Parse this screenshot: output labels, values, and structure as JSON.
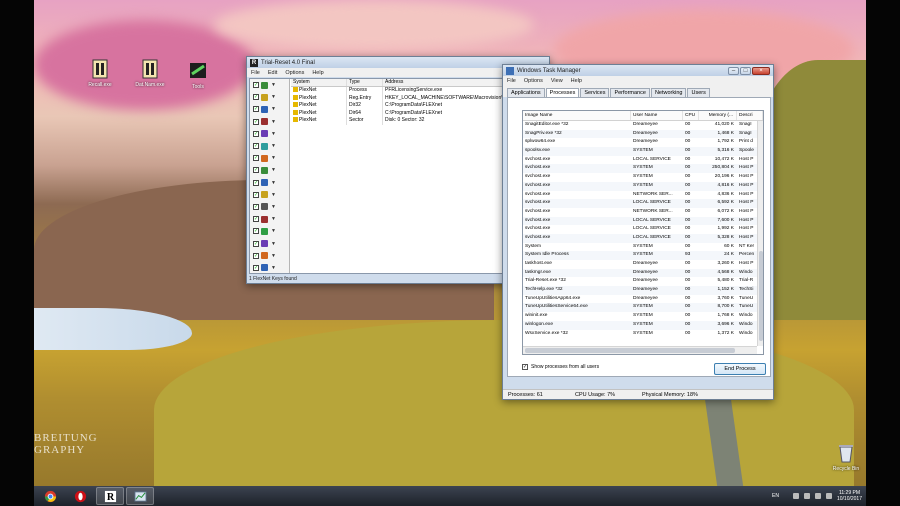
{
  "watermark": {
    "line1": "BREITUNG",
    "line2": "GRAPHY"
  },
  "desktop_icons": [
    {
      "label": "Recall.exe"
    },
    {
      "label": "Dat.Nam.exe"
    },
    {
      "label": "Tools"
    },
    {
      "label": "Recycle Bin"
    }
  ],
  "trial_reset": {
    "title": "Trial-Reset 4.0 Final",
    "menu": [
      "File",
      "Edit",
      "Options",
      "Help"
    ],
    "columns": [
      "System",
      "Type",
      "Address"
    ],
    "rows": [
      {
        "system": "PlexNet",
        "type": "Process",
        "address": "PFRLicensingService.exe"
      },
      {
        "system": "PlexNet",
        "type": "Reg.Entry",
        "address": "HKEY_LOCAL_MACHINE\\SOFTWARE\\Macrovision\\"
      },
      {
        "system": "PlexNet",
        "type": "Dir32",
        "address": "C:\\ProgramData\\FLEXnet"
      },
      {
        "system": "PlexNet",
        "type": "Dir64",
        "address": "C:\\ProgramData\\FLEXnet"
      },
      {
        "system": "PlexNet",
        "type": "Sector",
        "address": "Disk: 0 Sector: 32"
      }
    ],
    "status": "1 FlexNet Keys found"
  },
  "task_manager": {
    "title": "Windows Task Manager",
    "menu": [
      "File",
      "Options",
      "View",
      "Help"
    ],
    "tabs": [
      "Applications",
      "Processes",
      "Services",
      "Performance",
      "Networking",
      "Users"
    ],
    "active_tab": "Processes",
    "columns": [
      "Image Name",
      "User Name",
      "CPU",
      "Memory (...",
      "Descri"
    ],
    "rows": [
      {
        "name": "SnagitEditor.exe *32",
        "user": "Dreameyee",
        "cpu": "00",
        "mem": "41,020 K",
        "desc": "SnagI"
      },
      {
        "name": "SnagPriv.exe *32",
        "user": "Dreameyee",
        "cpu": "00",
        "mem": "1,468 K",
        "desc": "SnagI"
      },
      {
        "name": "splwow64.exe",
        "user": "Dreameyee",
        "cpu": "00",
        "mem": "1,792 K",
        "desc": "Print d"
      },
      {
        "name": "spoolsv.exe",
        "user": "SYSTEM",
        "cpu": "00",
        "mem": "5,316 K",
        "desc": "Spoole"
      },
      {
        "name": "svchost.exe",
        "user": "LOCAL SERVICE",
        "cpu": "00",
        "mem": "10,472 K",
        "desc": "Host P"
      },
      {
        "name": "svchost.exe",
        "user": "SYSTEM",
        "cpu": "00",
        "mem": "250,804 K",
        "desc": "Host P"
      },
      {
        "name": "svchost.exe",
        "user": "SYSTEM",
        "cpu": "00",
        "mem": "20,196 K",
        "desc": "Host P"
      },
      {
        "name": "svchost.exe",
        "user": "SYSTEM",
        "cpu": "00",
        "mem": "4,816 K",
        "desc": "Host P"
      },
      {
        "name": "svchost.exe",
        "user": "NETWORK SER...",
        "cpu": "00",
        "mem": "4,836 K",
        "desc": "Host P"
      },
      {
        "name": "svchost.exe",
        "user": "LOCAL SERVICE",
        "cpu": "00",
        "mem": "6,592 K",
        "desc": "Host P"
      },
      {
        "name": "svchost.exe",
        "user": "NETWORK SER...",
        "cpu": "00",
        "mem": "6,072 K",
        "desc": "Host P"
      },
      {
        "name": "svchost.exe",
        "user": "LOCAL SERVICE",
        "cpu": "00",
        "mem": "7,600 K",
        "desc": "Host P"
      },
      {
        "name": "svchost.exe",
        "user": "LOCAL SERVICE",
        "cpu": "00",
        "mem": "1,992 K",
        "desc": "Host P"
      },
      {
        "name": "svchost.exe",
        "user": "LOCAL SERVICE",
        "cpu": "00",
        "mem": "5,328 K",
        "desc": "Host P"
      },
      {
        "name": "System",
        "user": "SYSTEM",
        "cpu": "00",
        "mem": "60 K",
        "desc": "NT Ker"
      },
      {
        "name": "System Idle Process",
        "user": "SYSTEM",
        "cpu": "93",
        "mem": "24 K",
        "desc": "Percen"
      },
      {
        "name": "taskhost.exe",
        "user": "Dreameyee",
        "cpu": "00",
        "mem": "3,260 K",
        "desc": "Host P"
      },
      {
        "name": "taskmgr.exe",
        "user": "Dreameyee",
        "cpu": "00",
        "mem": "4,568 K",
        "desc": "Windo"
      },
      {
        "name": "Trial-Reset.exe *32",
        "user": "Dreameyee",
        "cpu": "00",
        "mem": "5,480 K",
        "desc": "Trial-R"
      },
      {
        "name": "TechHelp.exe *32",
        "user": "Dreameyee",
        "cpu": "00",
        "mem": "1,152 K",
        "desc": "TechSi"
      },
      {
        "name": "TuneUpUtilitiesApp64.exe",
        "user": "Dreameyee",
        "cpu": "00",
        "mem": "3,760 K",
        "desc": "TuneU"
      },
      {
        "name": "TuneUpUtilitiesService64.exe",
        "user": "SYSTEM",
        "cpu": "00",
        "mem": "8,700 K",
        "desc": "TuneU"
      },
      {
        "name": "wininit.exe",
        "user": "SYSTEM",
        "cpu": "00",
        "mem": "1,768 K",
        "desc": "Windo"
      },
      {
        "name": "winlogon.exe",
        "user": "SYSTEM",
        "cpu": "00",
        "mem": "3,696 K",
        "desc": "Windo"
      },
      {
        "name": "WsxService.exe *32",
        "user": "SYSTEM",
        "cpu": "00",
        "mem": "1,372 K",
        "desc": "Windo"
      }
    ],
    "show_all_label": "Show processes from all users",
    "end_process_label": "End Process",
    "status": {
      "processes": "Processes: 61",
      "cpu": "CPU Usage: 7%",
      "memory": "Physical Memory: 18%"
    }
  },
  "taskbar": {
    "lang": "EN",
    "time": "11:29 PM",
    "date": "10/10/2017"
  }
}
